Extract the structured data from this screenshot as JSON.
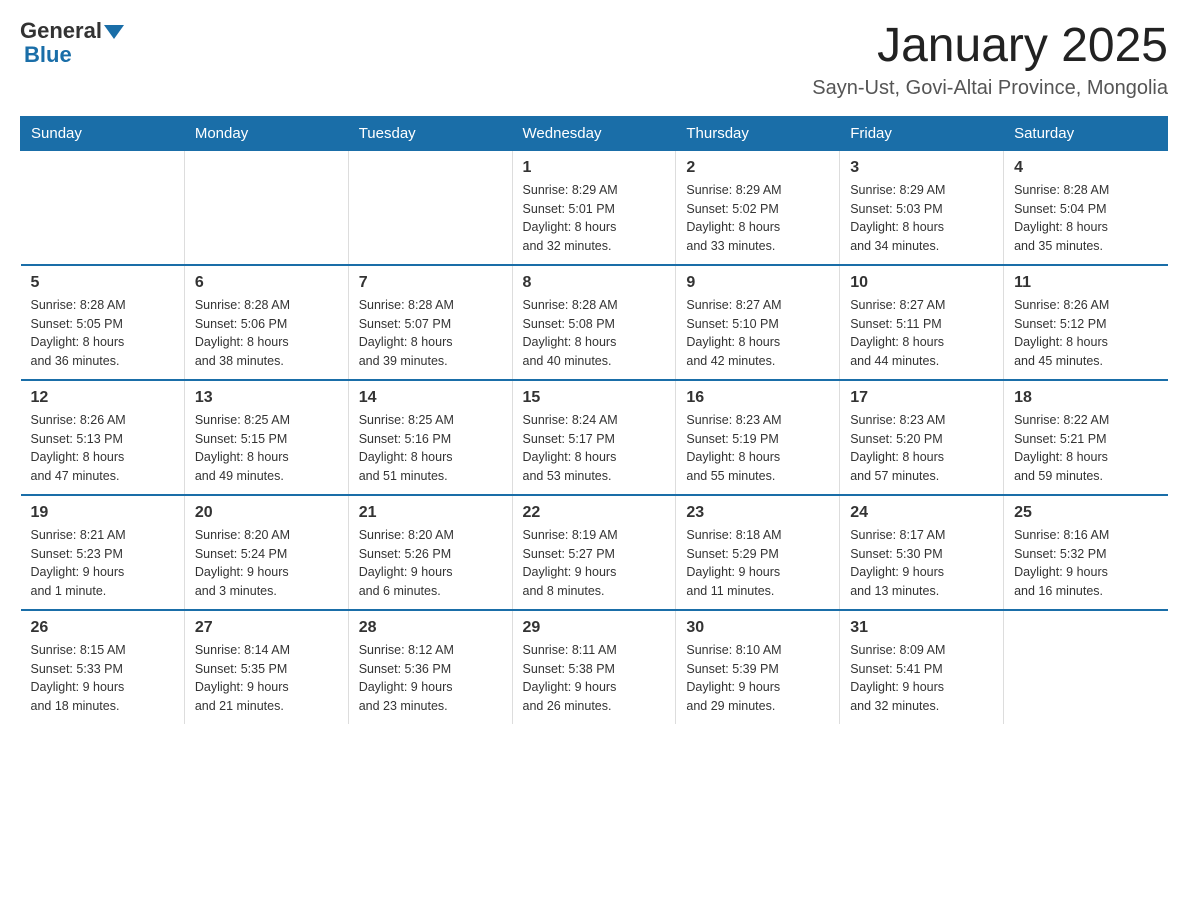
{
  "logo": {
    "general": "General",
    "blue": "Blue"
  },
  "header": {
    "title": "January 2025",
    "subtitle": "Sayn-Ust, Govi-Altai Province, Mongolia"
  },
  "weekdays": [
    "Sunday",
    "Monday",
    "Tuesday",
    "Wednesday",
    "Thursday",
    "Friday",
    "Saturday"
  ],
  "weeks": [
    [
      {
        "day": "",
        "info": ""
      },
      {
        "day": "",
        "info": ""
      },
      {
        "day": "",
        "info": ""
      },
      {
        "day": "1",
        "info": "Sunrise: 8:29 AM\nSunset: 5:01 PM\nDaylight: 8 hours\nand 32 minutes."
      },
      {
        "day": "2",
        "info": "Sunrise: 8:29 AM\nSunset: 5:02 PM\nDaylight: 8 hours\nand 33 minutes."
      },
      {
        "day": "3",
        "info": "Sunrise: 8:29 AM\nSunset: 5:03 PM\nDaylight: 8 hours\nand 34 minutes."
      },
      {
        "day": "4",
        "info": "Sunrise: 8:28 AM\nSunset: 5:04 PM\nDaylight: 8 hours\nand 35 minutes."
      }
    ],
    [
      {
        "day": "5",
        "info": "Sunrise: 8:28 AM\nSunset: 5:05 PM\nDaylight: 8 hours\nand 36 minutes."
      },
      {
        "day": "6",
        "info": "Sunrise: 8:28 AM\nSunset: 5:06 PM\nDaylight: 8 hours\nand 38 minutes."
      },
      {
        "day": "7",
        "info": "Sunrise: 8:28 AM\nSunset: 5:07 PM\nDaylight: 8 hours\nand 39 minutes."
      },
      {
        "day": "8",
        "info": "Sunrise: 8:28 AM\nSunset: 5:08 PM\nDaylight: 8 hours\nand 40 minutes."
      },
      {
        "day": "9",
        "info": "Sunrise: 8:27 AM\nSunset: 5:10 PM\nDaylight: 8 hours\nand 42 minutes."
      },
      {
        "day": "10",
        "info": "Sunrise: 8:27 AM\nSunset: 5:11 PM\nDaylight: 8 hours\nand 44 minutes."
      },
      {
        "day": "11",
        "info": "Sunrise: 8:26 AM\nSunset: 5:12 PM\nDaylight: 8 hours\nand 45 minutes."
      }
    ],
    [
      {
        "day": "12",
        "info": "Sunrise: 8:26 AM\nSunset: 5:13 PM\nDaylight: 8 hours\nand 47 minutes."
      },
      {
        "day": "13",
        "info": "Sunrise: 8:25 AM\nSunset: 5:15 PM\nDaylight: 8 hours\nand 49 minutes."
      },
      {
        "day": "14",
        "info": "Sunrise: 8:25 AM\nSunset: 5:16 PM\nDaylight: 8 hours\nand 51 minutes."
      },
      {
        "day": "15",
        "info": "Sunrise: 8:24 AM\nSunset: 5:17 PM\nDaylight: 8 hours\nand 53 minutes."
      },
      {
        "day": "16",
        "info": "Sunrise: 8:23 AM\nSunset: 5:19 PM\nDaylight: 8 hours\nand 55 minutes."
      },
      {
        "day": "17",
        "info": "Sunrise: 8:23 AM\nSunset: 5:20 PM\nDaylight: 8 hours\nand 57 minutes."
      },
      {
        "day": "18",
        "info": "Sunrise: 8:22 AM\nSunset: 5:21 PM\nDaylight: 8 hours\nand 59 minutes."
      }
    ],
    [
      {
        "day": "19",
        "info": "Sunrise: 8:21 AM\nSunset: 5:23 PM\nDaylight: 9 hours\nand 1 minute."
      },
      {
        "day": "20",
        "info": "Sunrise: 8:20 AM\nSunset: 5:24 PM\nDaylight: 9 hours\nand 3 minutes."
      },
      {
        "day": "21",
        "info": "Sunrise: 8:20 AM\nSunset: 5:26 PM\nDaylight: 9 hours\nand 6 minutes."
      },
      {
        "day": "22",
        "info": "Sunrise: 8:19 AM\nSunset: 5:27 PM\nDaylight: 9 hours\nand 8 minutes."
      },
      {
        "day": "23",
        "info": "Sunrise: 8:18 AM\nSunset: 5:29 PM\nDaylight: 9 hours\nand 11 minutes."
      },
      {
        "day": "24",
        "info": "Sunrise: 8:17 AM\nSunset: 5:30 PM\nDaylight: 9 hours\nand 13 minutes."
      },
      {
        "day": "25",
        "info": "Sunrise: 8:16 AM\nSunset: 5:32 PM\nDaylight: 9 hours\nand 16 minutes."
      }
    ],
    [
      {
        "day": "26",
        "info": "Sunrise: 8:15 AM\nSunset: 5:33 PM\nDaylight: 9 hours\nand 18 minutes."
      },
      {
        "day": "27",
        "info": "Sunrise: 8:14 AM\nSunset: 5:35 PM\nDaylight: 9 hours\nand 21 minutes."
      },
      {
        "day": "28",
        "info": "Sunrise: 8:12 AM\nSunset: 5:36 PM\nDaylight: 9 hours\nand 23 minutes."
      },
      {
        "day": "29",
        "info": "Sunrise: 8:11 AM\nSunset: 5:38 PM\nDaylight: 9 hours\nand 26 minutes."
      },
      {
        "day": "30",
        "info": "Sunrise: 8:10 AM\nSunset: 5:39 PM\nDaylight: 9 hours\nand 29 minutes."
      },
      {
        "day": "31",
        "info": "Sunrise: 8:09 AM\nSunset: 5:41 PM\nDaylight: 9 hours\nand 32 minutes."
      },
      {
        "day": "",
        "info": ""
      }
    ]
  ]
}
